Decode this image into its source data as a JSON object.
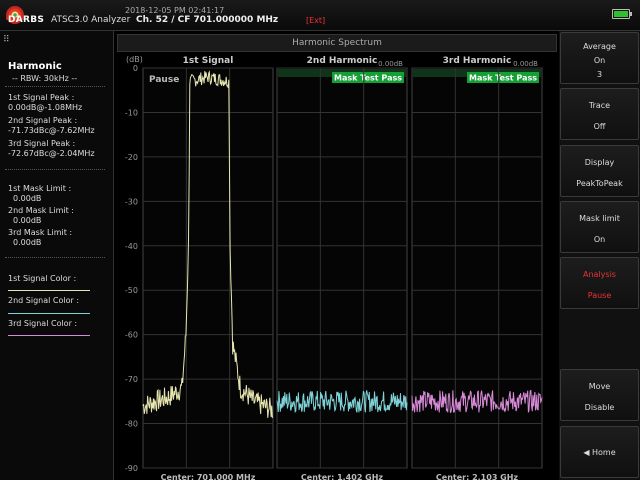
{
  "header": {
    "brand": "DARBS",
    "datetime": "2018-12-05 PM 02:41:17",
    "app_title": "ATSC3.0 Analyzer",
    "channel": "Ch. 52 / CF 701.000000 MHz",
    "ext": "[Ext]"
  },
  "left_panel": {
    "title": "Harmonic",
    "rbw": "-- RBW: 30kHz --",
    "peaks": [
      {
        "label": "1st Signal Peak :",
        "value": "0.00dB@-1.08MHz"
      },
      {
        "label": "2nd Signal Peak :",
        "value": "-71.73dBc@-7.62MHz"
      },
      {
        "label": "3rd Signal Peak :",
        "value": "-72.67dBc@-2.04MHz"
      }
    ],
    "mask_limits": [
      {
        "label": "1st Mask Limit :",
        "value": "0.00dB"
      },
      {
        "label": "2nd Mask Limit :",
        "value": "0.00dB"
      },
      {
        "label": "3rd Mask Limit :",
        "value": "0.00dB"
      }
    ],
    "signal_colors": [
      {
        "label": "1st Signal Color :",
        "color": "#e8e6b0"
      },
      {
        "label": "2nd Signal Color :",
        "color": "#7fd3d8"
      },
      {
        "label": "3rd Signal Color :",
        "color": "#d88ad8"
      }
    ]
  },
  "spectrum": {
    "title": "Harmonic Spectrum",
    "unit": "(dB)",
    "pause_label": "Pause",
    "y_ticks": [
      "0",
      "-10",
      "-20",
      "-30",
      "-40",
      "-50",
      "-60",
      "-70",
      "-80",
      "-90"
    ],
    "panels": [
      {
        "title": "1st Signal",
        "center": "Center: 701.000 MHz",
        "mask": "",
        "mask_level": ""
      },
      {
        "title": "2nd Harmonic",
        "center": "Center: 1.402 GHz",
        "mask": "Mask Test Pass",
        "mask_level": "0.00dB"
      },
      {
        "title": "3rd Harmonic",
        "center": "Center: 2.103 GHz",
        "mask": "Mask Test Pass",
        "mask_level": "0.00dB"
      }
    ]
  },
  "chart_data": {
    "type": "line",
    "ylabel": "(dB)",
    "ylim": [
      -90,
      0
    ],
    "y_ticks": [
      0,
      -10,
      -20,
      -30,
      -40,
      -50,
      -60,
      -70,
      -80,
      -90
    ],
    "grid": true,
    "series": [
      {
        "name": "1st Signal",
        "color": "#e8e6b0",
        "center": "701.000 MHz",
        "x": [
          0,
          0.1,
          0.2,
          0.3,
          0.33,
          0.35,
          0.36,
          0.5,
          0.66,
          0.67,
          0.69,
          0.75,
          0.85,
          1.0
        ],
        "y": [
          -76,
          -75,
          -74,
          -72,
          -60,
          -40,
          -3,
          -2,
          -3,
          -40,
          -62,
          -72,
          -75,
          -77
        ]
      },
      {
        "name": "2nd Harmonic",
        "color": "#7fd3d8",
        "center": "1.402 GHz",
        "x": [
          0,
          0.25,
          0.5,
          0.75,
          1.0
        ],
        "y": [
          -75,
          -75,
          -75,
          -75,
          -75
        ]
      },
      {
        "name": "3rd Harmonic",
        "color": "#d88ad8",
        "center": "2.103 GHz",
        "x": [
          0,
          0.25,
          0.5,
          0.75,
          1.0
        ],
        "y": [
          -75,
          -75,
          -75,
          -75,
          -75
        ]
      }
    ]
  },
  "right_panel": {
    "buttons": [
      {
        "line1": "Average",
        "line2": "On",
        "line3": "3"
      },
      {
        "line1": "Trace",
        "line2": "Off",
        "line3": ""
      },
      {
        "line1": "Display",
        "line2": "PeakToPeak",
        "line3": ""
      },
      {
        "line1": "Mask limit",
        "line2": "On",
        "line3": ""
      },
      {
        "line1": "Analysis",
        "line2": "Pause",
        "line3": ""
      },
      {
        "line1": "Move",
        "line2": "Disable",
        "line3": ""
      },
      {
        "line1": "◀ Home",
        "line2": "",
        "line3": ""
      }
    ]
  }
}
